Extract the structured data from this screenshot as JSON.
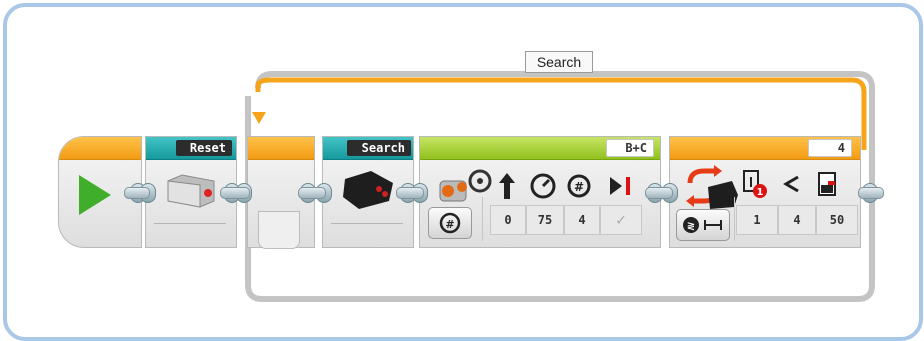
{
  "loop": {
    "label": "Search"
  },
  "blocks": {
    "reset": {
      "label": "Reset"
    },
    "search": {
      "label": "Search"
    },
    "move_tank": {
      "ports": "B+C",
      "params": [
        "0",
        "75",
        "4",
        "✓"
      ]
    },
    "wait": {
      "port": "4",
      "params": [
        "1",
        "4",
        "50"
      ]
    }
  },
  "colors": {
    "start_cap": "#f7a81b",
    "teal_cap": "#1aa4a7",
    "green_cap": "#9ccb2b",
    "loop_rail": "#f7a81b",
    "frame": "#a9c7e6"
  }
}
